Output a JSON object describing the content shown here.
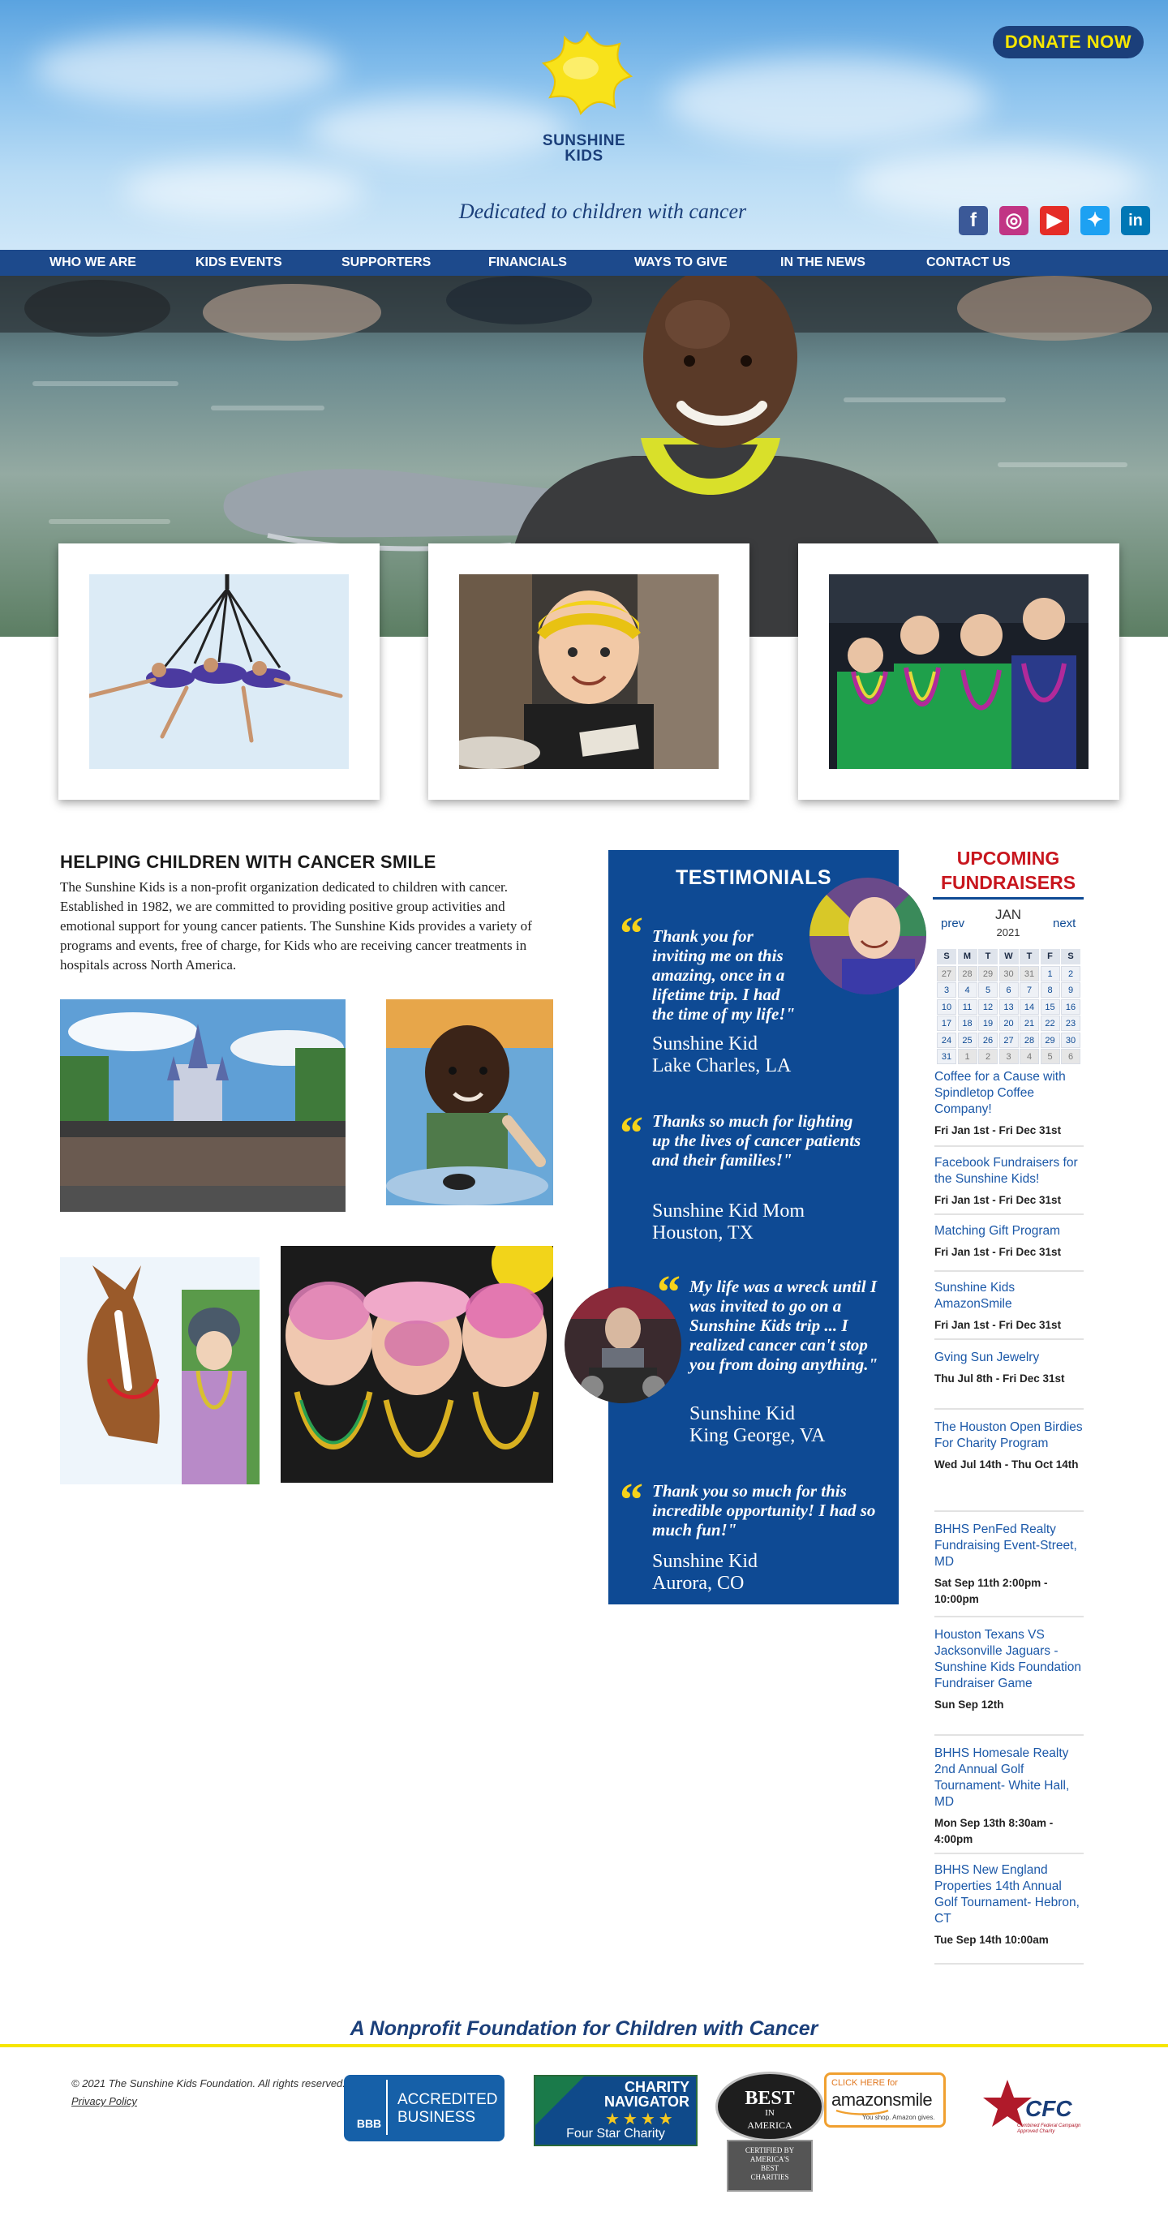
{
  "header": {
    "donate_label": "DONATE NOW",
    "logo_line1": "SUNSHINE",
    "logo_line2": "KIDS",
    "tagline": "Dedicated to children with cancer",
    "social": [
      {
        "icon": "facebook-icon",
        "glyph": "f",
        "color": "#3b5998"
      },
      {
        "icon": "instagram-icon",
        "glyph": "◎",
        "color": "#c13584"
      },
      {
        "icon": "youtube-icon",
        "glyph": "▶",
        "color": "#e52d27"
      },
      {
        "icon": "twitter-icon",
        "glyph": "✦",
        "color": "#1da1f2"
      },
      {
        "icon": "linkedin-icon",
        "glyph": "in",
        "color": "#0077b5"
      }
    ]
  },
  "nav": {
    "items": [
      "WHO WE ARE",
      "KIDS EVENTS",
      "SUPPORTERS",
      "FINANCIALS",
      "WAYS TO GIVE",
      "IN THE NEWS",
      "CONTACT US"
    ]
  },
  "about": {
    "title": "HELPING CHILDREN WITH CANCER SMILE",
    "body": "The Sunshine Kids is a non-profit organization dedicated to children with cancer. Established in 1982, we are committed to providing positive group activities and emotional support for young cancer patients. The Sunshine Kids provides a variety of programs and events, free of charge, for Kids who are receiving cancer treatments in hospitals across North America."
  },
  "testimonials": {
    "title": "TESTIMONIALS",
    "items": [
      {
        "quote": "Thank you for inviting me on this amazing, once in a lifetime trip. I had the time of my life!\"",
        "name": "Sunshine Kid",
        "place": "Lake Charles, LA"
      },
      {
        "quote": "Thanks so much for lighting up the lives of cancer patients and their families!\"",
        "name": "Sunshine Kid Mom",
        "place": "Houston, TX"
      },
      {
        "quote": "My life was a wreck until I was invited to go on a Sunshine Kids trip ... I realized cancer can't stop you from doing anything.\"",
        "name": "Sunshine Kid",
        "place": "King George, VA"
      },
      {
        "quote": "Thank you so much for this incredible opportunity! I had so much fun!\"",
        "name": "Sunshine Kid",
        "place": "Aurora, CO"
      }
    ]
  },
  "fundraisers": {
    "title_line1": "UPCOMING",
    "title_line2": "FUNDRAISERS",
    "calendar": {
      "prev": "prev",
      "next": "next",
      "month": "JAN",
      "year": "2021",
      "weekdays": [
        "S",
        "M",
        "T",
        "W",
        "T",
        "F",
        "S"
      ],
      "weeks": [
        [
          "27",
          "28",
          "29",
          "30",
          "31",
          "1",
          "2"
        ],
        [
          "3",
          "4",
          "5",
          "6",
          "7",
          "8",
          "9"
        ],
        [
          "10",
          "11",
          "12",
          "13",
          "14",
          "15",
          "16"
        ],
        [
          "17",
          "18",
          "19",
          "20",
          "21",
          "22",
          "23"
        ],
        [
          "24",
          "25",
          "26",
          "27",
          "28",
          "29",
          "30"
        ],
        [
          "31",
          "1",
          "2",
          "3",
          "4",
          "5",
          "6"
        ]
      ]
    },
    "events": [
      {
        "title": "Coffee for a Cause with Spindletop Coffee Company!",
        "date": "Fri Jan 1st - Fri Dec 31st"
      },
      {
        "title": "Facebook Fundraisers for the Sunshine Kids!",
        "date": "Fri Jan 1st - Fri Dec 31st"
      },
      {
        "title": "Matching Gift Program",
        "date": "Fri Jan 1st - Fri Dec 31st"
      },
      {
        "title": "Sunshine Kids AmazonSmile",
        "date": "Fri Jan 1st - Fri Dec 31st"
      },
      {
        "title": "Gving Sun Jewelry",
        "date": "Thu Jul 8th - Fri Dec 31st"
      },
      {
        "title": "The Houston Open Birdies For Charity Program",
        "date": "Wed Jul 14th - Thu Oct 14th"
      },
      {
        "title": "BHHS PenFed Realty Fundraising Event-Street, MD",
        "date": "Sat Sep 11th 2:00pm - 10:00pm"
      },
      {
        "title": "Houston Texans VS Jacksonville Jaguars - Sunshine Kids Foundation Fundraiser Game",
        "date": "Sun Sep 12th"
      },
      {
        "title": "BHHS Homesale Realty 2nd Annual Golf Tournament- White Hall, MD",
        "date": "Mon Sep 13th 8:30am - 4:00pm"
      },
      {
        "title": "BHHS New England Properties 14th Annual Golf Tournament- Hebron, CT",
        "date": "Tue Sep 14th 10:00am"
      }
    ]
  },
  "footer": {
    "tagline": "A Nonprofit Foundation for Children with Cancer",
    "copyright": "© 2021 The Sunshine Kids Foundation. All rights reserved.",
    "privacy": "Privacy Policy",
    "bbb": {
      "mark": "BBB",
      "line1": "ACCREDITED",
      "line2": "BUSINESS"
    },
    "charity_navigator": {
      "line1": "CHARITY",
      "line2": "NAVIGATOR",
      "stars": "★★★★",
      "line3": "Four Star Charity"
    },
    "best_charities": {
      "line1": "BEST",
      "line2": "IN",
      "line3": "AMERICA",
      "line4": "CERTIFIED BY",
      "line5": "AMERICA'S",
      "line6": "BEST",
      "line7": "CHARITIES"
    },
    "amazon": {
      "line1": "CLICK HERE for",
      "line2": "amazonsmile",
      "line3": "You shop. Amazon gives."
    },
    "cfc": {
      "mark": "CFC",
      "line1": "Combined Federal Campaign",
      "line2": "Approved Charity"
    }
  },
  "colors": {
    "brand_blue": "#1b3f7a",
    "nav_blue": "#1d4a8c",
    "testimonial_blue": "#0e4a94",
    "sunshine_yellow": "#f6e600",
    "fundraiser_red": "#c8161e",
    "link_blue": "#1b58a8"
  }
}
